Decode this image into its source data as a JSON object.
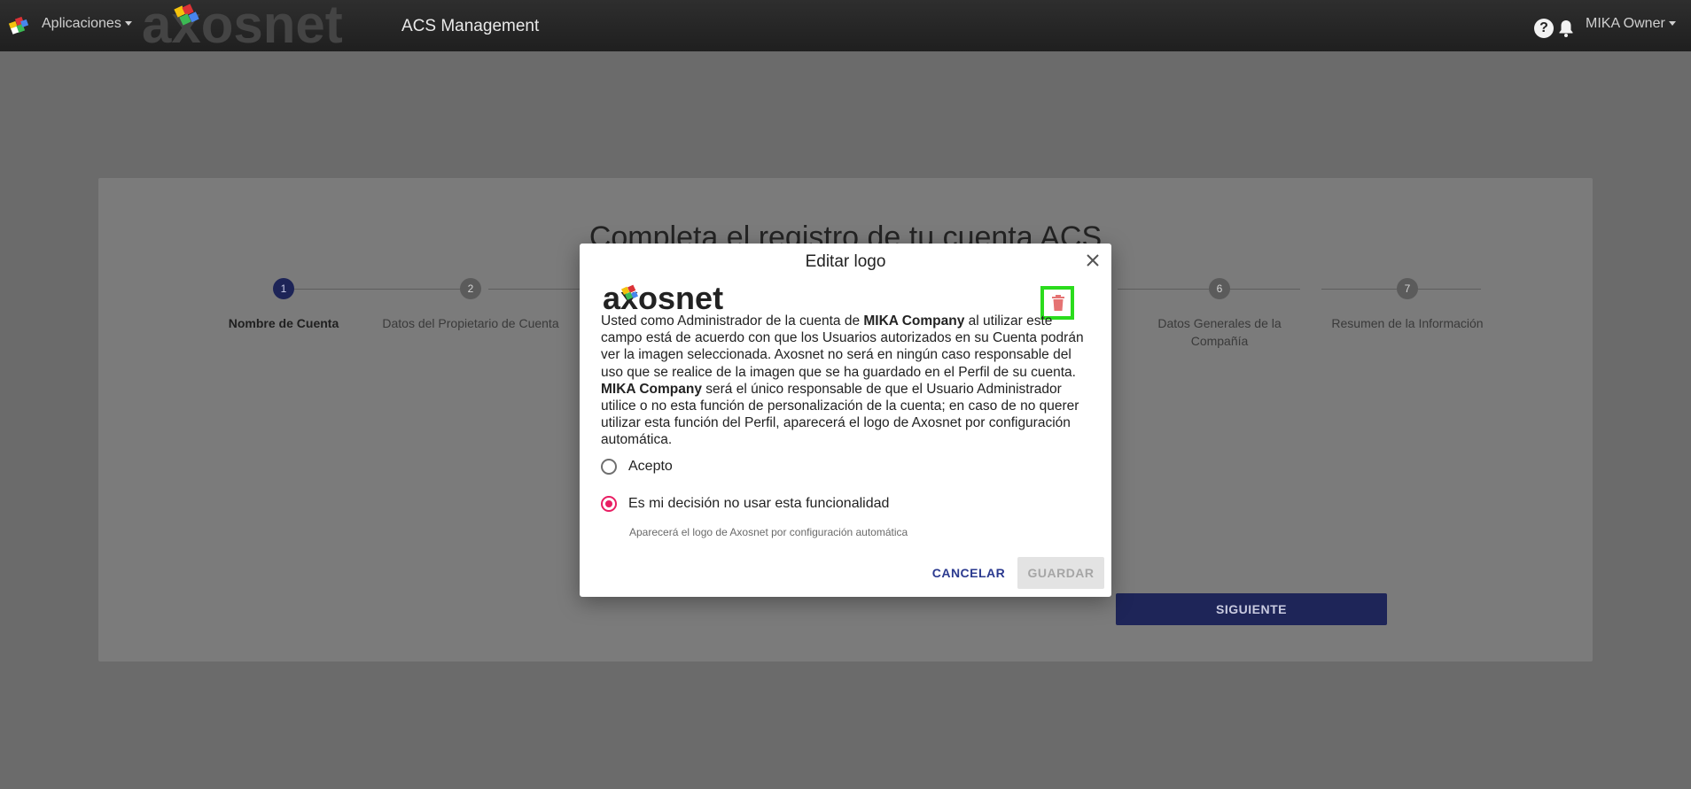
{
  "topbar": {
    "apps_label": "Aplicaciones",
    "brand_text": "axosnet",
    "app_title": "ACS Management",
    "help_glyph": "?",
    "user_label": "MIKA Owner",
    "icons": [
      "apps-icon",
      "help-icon",
      "bell-icon"
    ]
  },
  "background": {
    "title": "Completa el registro de tu cuenta ACS",
    "steps": [
      {
        "num": "1",
        "label": "Nombre de Cuenta",
        "active": true
      },
      {
        "num": "2",
        "label": "Datos del Propietario de Cuenta",
        "active": false
      },
      {
        "num": "6",
        "label": "Datos Generales de la Compañía",
        "active": false
      },
      {
        "num": "7",
        "label": "Resumen de la Información",
        "active": false
      }
    ],
    "next_label": "SIGUIENTE"
  },
  "modal": {
    "title": "Editar logo",
    "logo_text": "axosnet",
    "text_parts": {
      "p1": "Usted como Administrador de la cuenta de ",
      "company1": "MIKA Company",
      "p2": " al utilizar este campo está de acuerdo con que los Usuarios autorizados en su Cuenta podrán ver la imagen seleccionada. Axosnet no será en ningún caso responsable del uso que se realice de la imagen que se ha guardado en el Perfil de su cuenta. ",
      "company2": "MIKA Company",
      "p3": " será el único responsable de que el Usuario Administrador utilice o no esta función de personalización de la cuenta; en caso de no querer utilizar esta función del Perfil, aparecerá el logo de Axosnet por configuración automática."
    },
    "options": [
      {
        "label": "Acepto",
        "checked": false
      },
      {
        "label": "Es mi decisión no usar esta funcionalidad",
        "checked": true
      }
    ],
    "hint": "Aparecerá el logo de Axosnet por configuración automática",
    "cancel_label": "CANCELAR",
    "save_label": "GUARDAR",
    "icons": [
      "close-icon",
      "trash-icon"
    ],
    "colors": {
      "accent": "#2b3a8f",
      "radio_checked": "#e91e63",
      "trash": "#e57373",
      "highlight": "#2bdc1d"
    }
  }
}
